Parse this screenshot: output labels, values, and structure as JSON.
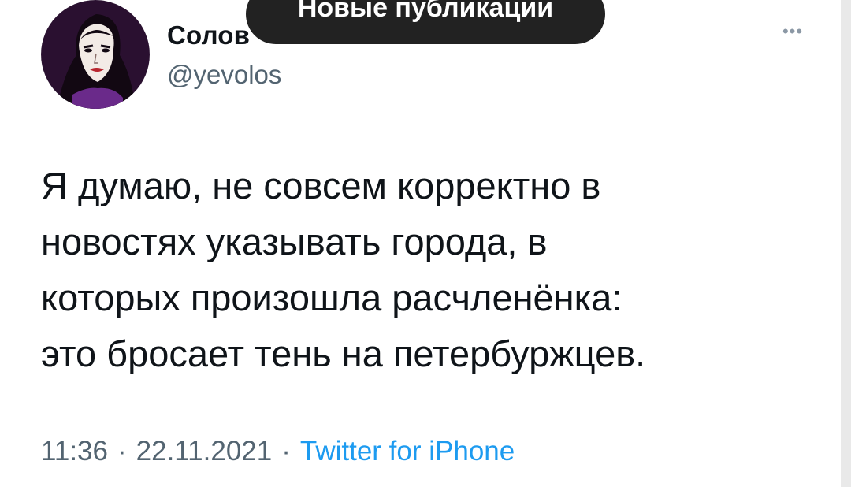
{
  "toast": {
    "label": "Новые публикации"
  },
  "author": {
    "display_name": "Солов",
    "handle": "@yevolos"
  },
  "more_icon": "more-horizontal-icon",
  "tweet": {
    "lines": [
      "Я думаю, не совсем корректно в",
      "новостях указывать города, в",
      "которых произошла расчленёнка:",
      "это бросает тень на петербуржцев."
    ]
  },
  "meta": {
    "time": "11:36",
    "separator": "·",
    "date": "22.11.2021",
    "source": "Twitter for iPhone"
  },
  "colors": {
    "text": "#0f1419",
    "secondary": "#536471",
    "link": "#1d9bf0",
    "toast_bg": "#222222"
  }
}
